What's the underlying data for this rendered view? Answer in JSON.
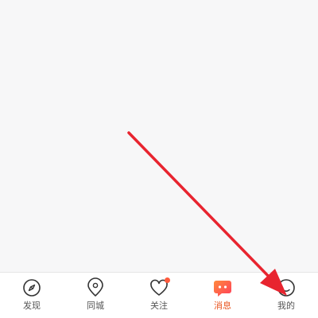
{
  "tabbar": {
    "items": [
      {
        "label": "发现",
        "icon": "compass-icon",
        "active": false
      },
      {
        "label": "同城",
        "icon": "location-pin-icon",
        "active": false
      },
      {
        "label": "关注",
        "icon": "heart-icon",
        "active": false,
        "badge": true
      },
      {
        "label": "消息",
        "icon": "chat-bubble-icon",
        "active": true
      },
      {
        "label": "我的",
        "icon": "profile-icon",
        "active": false
      }
    ]
  },
  "colors": {
    "active": "#e8541e",
    "inactive": "#555555",
    "badge": "#ff5a3c",
    "arrow": "#e8242f"
  }
}
